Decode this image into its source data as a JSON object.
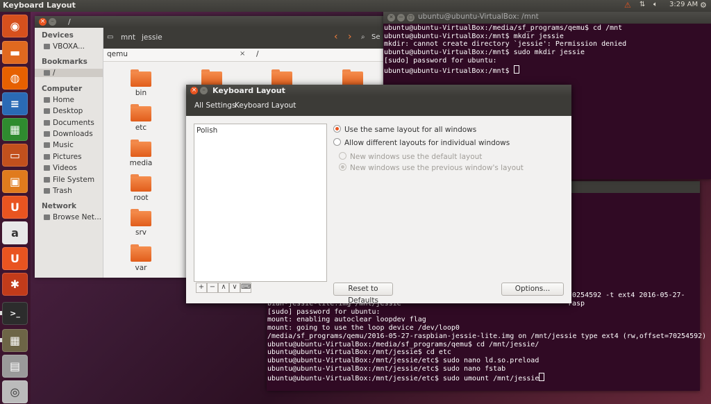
{
  "top_panel": {
    "title": "Keyboard Layout",
    "clock": "3:29 AM"
  },
  "launcher": {
    "items": [
      {
        "name": "dash-home",
        "color": "#d6501d",
        "glyph": "◉"
      },
      {
        "name": "files",
        "color": "#e0691f",
        "glyph": "▬"
      },
      {
        "name": "firefox",
        "color": "#e66000",
        "glyph": "◍"
      },
      {
        "name": "libreoffice-writer",
        "color": "#2a6ab5",
        "glyph": "≡"
      },
      {
        "name": "libreoffice-calc",
        "color": "#2f8b2f",
        "glyph": "▦"
      },
      {
        "name": "libreoffice-impress",
        "color": "#c2501d",
        "glyph": "▭"
      },
      {
        "name": "software-center",
        "color": "#e07b1d",
        "glyph": "▣"
      },
      {
        "name": "ubuntu-one",
        "color": "#e95420",
        "glyph": "U"
      },
      {
        "name": "amazon",
        "color": "#e8e8e8",
        "glyph": "a"
      },
      {
        "name": "ubuntu-one-music",
        "color": "#e95420",
        "glyph": "U"
      },
      {
        "name": "system-settings",
        "color": "#c23b1a",
        "glyph": "✱"
      },
      {
        "name": "terminal",
        "color": "#2c2c2c",
        "glyph": ">_"
      },
      {
        "name": "workspace-switcher",
        "color": "#6d6546",
        "glyph": "▦"
      },
      {
        "name": "screenshot",
        "color": "#9a9a9a",
        "glyph": "▤"
      },
      {
        "name": "dvd",
        "color": "#bbbbbb",
        "glyph": "◎"
      }
    ]
  },
  "files_window": {
    "title": "/",
    "breadcrumb": [
      "mnt",
      "jessie"
    ],
    "search_label": "Se",
    "location_text": "qemu",
    "path_text": "/",
    "sidebar": {
      "sections": [
        {
          "header": "Devices",
          "items": [
            "VBOXA..."
          ]
        },
        {
          "header": "Bookmarks",
          "items": [
            "/"
          ]
        },
        {
          "header": "Computer",
          "items": [
            "Home",
            "Desktop",
            "Documents",
            "Downloads",
            "Music",
            "Pictures",
            "Videos",
            "File System",
            "Trash"
          ]
        },
        {
          "header": "Network",
          "items": [
            "Browse Net..."
          ]
        }
      ]
    },
    "folders": [
      "bin",
      "etc",
      "media",
      "root",
      "srv",
      "var"
    ]
  },
  "terminal_top": {
    "title": "ubuntu@ubuntu-VirtualBox: /mnt",
    "lines": [
      "ubuntu@ubuntu-VirtualBox:/media/sf_programs/qemu$ cd /mnt",
      "ubuntu@ubuntu-VirtualBox:/mnt$ mkdir jessie",
      "mkdir: cannot create directory `jessie': Permission denied",
      "ubuntu@ubuntu-VirtualBox:/mnt$ sudo mkdir jessie",
      "[sudo] password for ubuntu:",
      "ubuntu@ubuntu-VirtualBox:/mnt$ "
    ]
  },
  "terminal_bottom": {
    "side_text": "70254592 -t ext4 2016-05-27-rasp",
    "lines": [
      "bian-jessie-lite.img /mnt/jessie",
      "[sudo] password for ubuntu:",
      "mount: enabling autoclear loopdev flag",
      "mount: going to use the loop device /dev/loop0",
      "/media/sf_programs/qemu/2016-05-27-raspbian-jessie-lite.img on /mnt/jessie type ext4 (rw,offset=70254592)",
      "ubuntu@ubuntu-VirtualBox:/media/sf_programs/qemu$ cd /mnt/jessie/",
      "ubuntu@ubuntu-VirtualBox:/mnt/jessie$ cd etc",
      "ubuntu@ubuntu-VirtualBox:/mnt/jessie/etc$ sudo nano ld.so.preload",
      "ubuntu@ubuntu-VirtualBox:/mnt/jessie/etc$ sudo nano fstab",
      "ubuntu@ubuntu-VirtualBox:/mnt/jessie/etc$ sudo umount /mnt/jessie"
    ]
  },
  "keyboard_dialog": {
    "title": "Keyboard Layout",
    "nav": {
      "all_settings": "All Settings",
      "current": "Keyboard Layout"
    },
    "layouts": [
      "Polish"
    ],
    "options": {
      "same_layout": "Use the same layout for all windows",
      "different_layouts": "Allow different layouts for individual windows",
      "new_default": "New windows use the default layout",
      "new_previous": "New windows use the previous window's layout"
    },
    "tools": {
      "add": "+",
      "remove": "−",
      "up": "∧",
      "down": "∨",
      "keyboard": "⌨"
    },
    "reset_button": "Reset to Defaults",
    "options_button": "Options..."
  },
  "colors": {
    "accent": "#e95420",
    "panel": "#3c3b37",
    "terminal_bg": "#300a24"
  }
}
